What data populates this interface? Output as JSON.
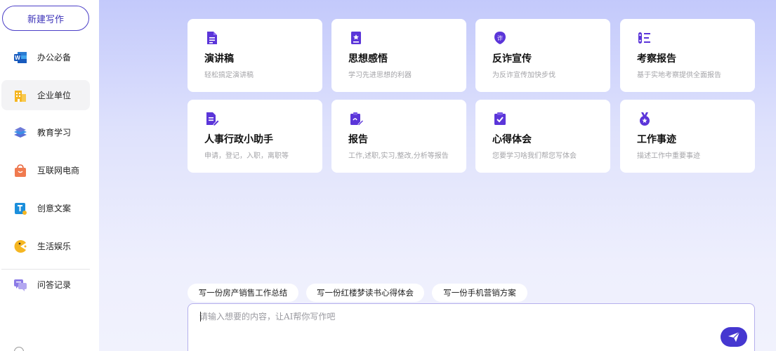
{
  "sidebar": {
    "new_button": "新建写作",
    "items": [
      {
        "label": "办公必备",
        "icon": "word-doc-icon"
      },
      {
        "label": "企业单位",
        "icon": "building-icon"
      },
      {
        "label": "教育学习",
        "icon": "books-icon"
      },
      {
        "label": "互联网电商",
        "icon": "shopping-bag-icon"
      },
      {
        "label": "创意文案",
        "icon": "text-t-icon"
      },
      {
        "label": "生活娱乐",
        "icon": "pacman-icon"
      }
    ],
    "history": {
      "label": "问答记录",
      "icon": "chat-bubbles-icon"
    }
  },
  "cards": [
    {
      "title": "演讲稿",
      "desc": "轻松搞定演讲稿",
      "icon": "document-icon"
    },
    {
      "title": "思想感悟",
      "desc": "学习先进思想的利器",
      "icon": "bookmark-star-icon"
    },
    {
      "title": "反诈宣传",
      "desc": "为反诈宣传加快步伐",
      "icon": "anti-fraud-shield-icon"
    },
    {
      "title": "考察报告",
      "desc": "基于实地考察提供全面报告",
      "icon": "list-report-icon"
    },
    {
      "title": "人事行政小助手",
      "desc": "申请，登记，入职，离职等",
      "icon": "edit-document-icon"
    },
    {
      "title": "报告",
      "desc": "工作,述职,实习,整改,分析等报告",
      "icon": "clipboard-edit-icon"
    },
    {
      "title": "心得体会",
      "desc": "您要学习啥我们帮您写体会",
      "icon": "clipboard-check-icon"
    },
    {
      "title": "工作事迹",
      "desc": "描述工作中重要事迹",
      "icon": "medal-icon"
    }
  ],
  "suggestions": [
    "写一份房产销售工作总结",
    "写一份红楼梦读书心得体会",
    "写一份手机营销方案"
  ],
  "input": {
    "placeholder": "请输入想要的内容，让AI帮你写作吧",
    "value": ""
  },
  "colors": {
    "accent": "#4537d0",
    "icon_purple": "#5b35d9"
  }
}
